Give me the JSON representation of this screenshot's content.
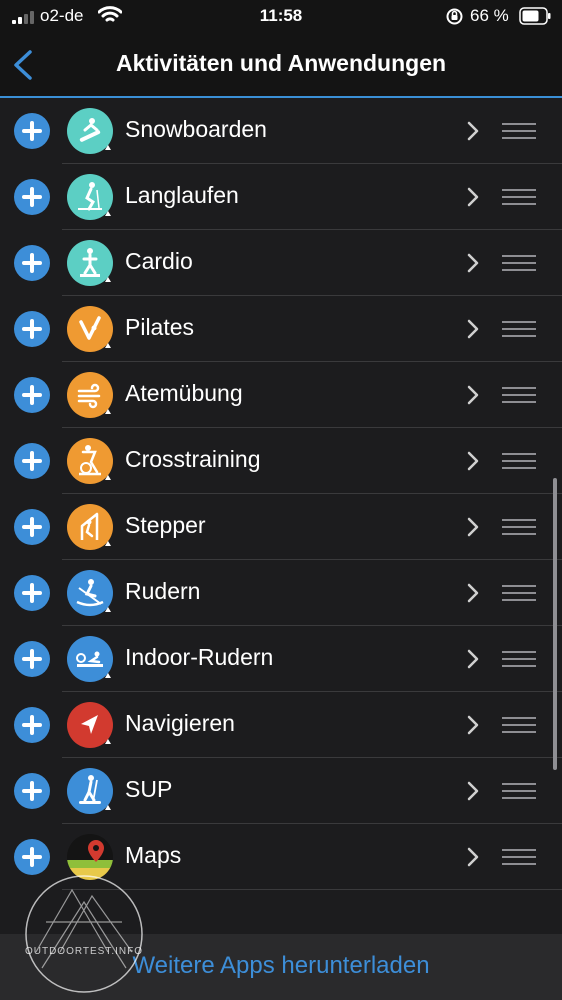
{
  "status_bar": {
    "carrier": "o2-de",
    "time": "11:58",
    "battery": "66 %"
  },
  "nav": {
    "title": "Aktivitäten und Anwendungen"
  },
  "colors": {
    "accent": "#3d8ed8",
    "teal": "#5ccfc4",
    "orange": "#ef9a32",
    "blue": "#3d8ed8",
    "red": "#d23a2f"
  },
  "items": [
    {
      "label": "Snowboarden",
      "icon": "snowboard-icon",
      "color": "#5ccfc4"
    },
    {
      "label": "Langlaufen",
      "icon": "cross-country-ski-icon",
      "color": "#5ccfc4"
    },
    {
      "label": "Cardio",
      "icon": "cardio-icon",
      "color": "#5ccfc4"
    },
    {
      "label": "Pilates",
      "icon": "pilates-icon",
      "color": "#ef9a32"
    },
    {
      "label": "Atemübung",
      "icon": "breathwork-icon",
      "color": "#ef9a32"
    },
    {
      "label": "Crosstraining",
      "icon": "elliptical-icon",
      "color": "#ef9a32"
    },
    {
      "label": "Stepper",
      "icon": "stair-stepper-icon",
      "color": "#ef9a32"
    },
    {
      "label": "Rudern",
      "icon": "rowing-icon",
      "color": "#3d8ed8"
    },
    {
      "label": "Indoor-Rudern",
      "icon": "indoor-rowing-icon",
      "color": "#3d8ed8"
    },
    {
      "label": "Navigieren",
      "icon": "navigate-icon",
      "color": "#d23a2f"
    },
    {
      "label": "SUP",
      "icon": "sup-icon",
      "color": "#3d8ed8"
    },
    {
      "label": "Maps",
      "icon": "maps-icon",
      "color": "multicolor"
    }
  ],
  "bottom": {
    "link": "Weitere Apps herunterladen"
  },
  "watermark": {
    "text": "OUTDOORTEST.INFO"
  }
}
